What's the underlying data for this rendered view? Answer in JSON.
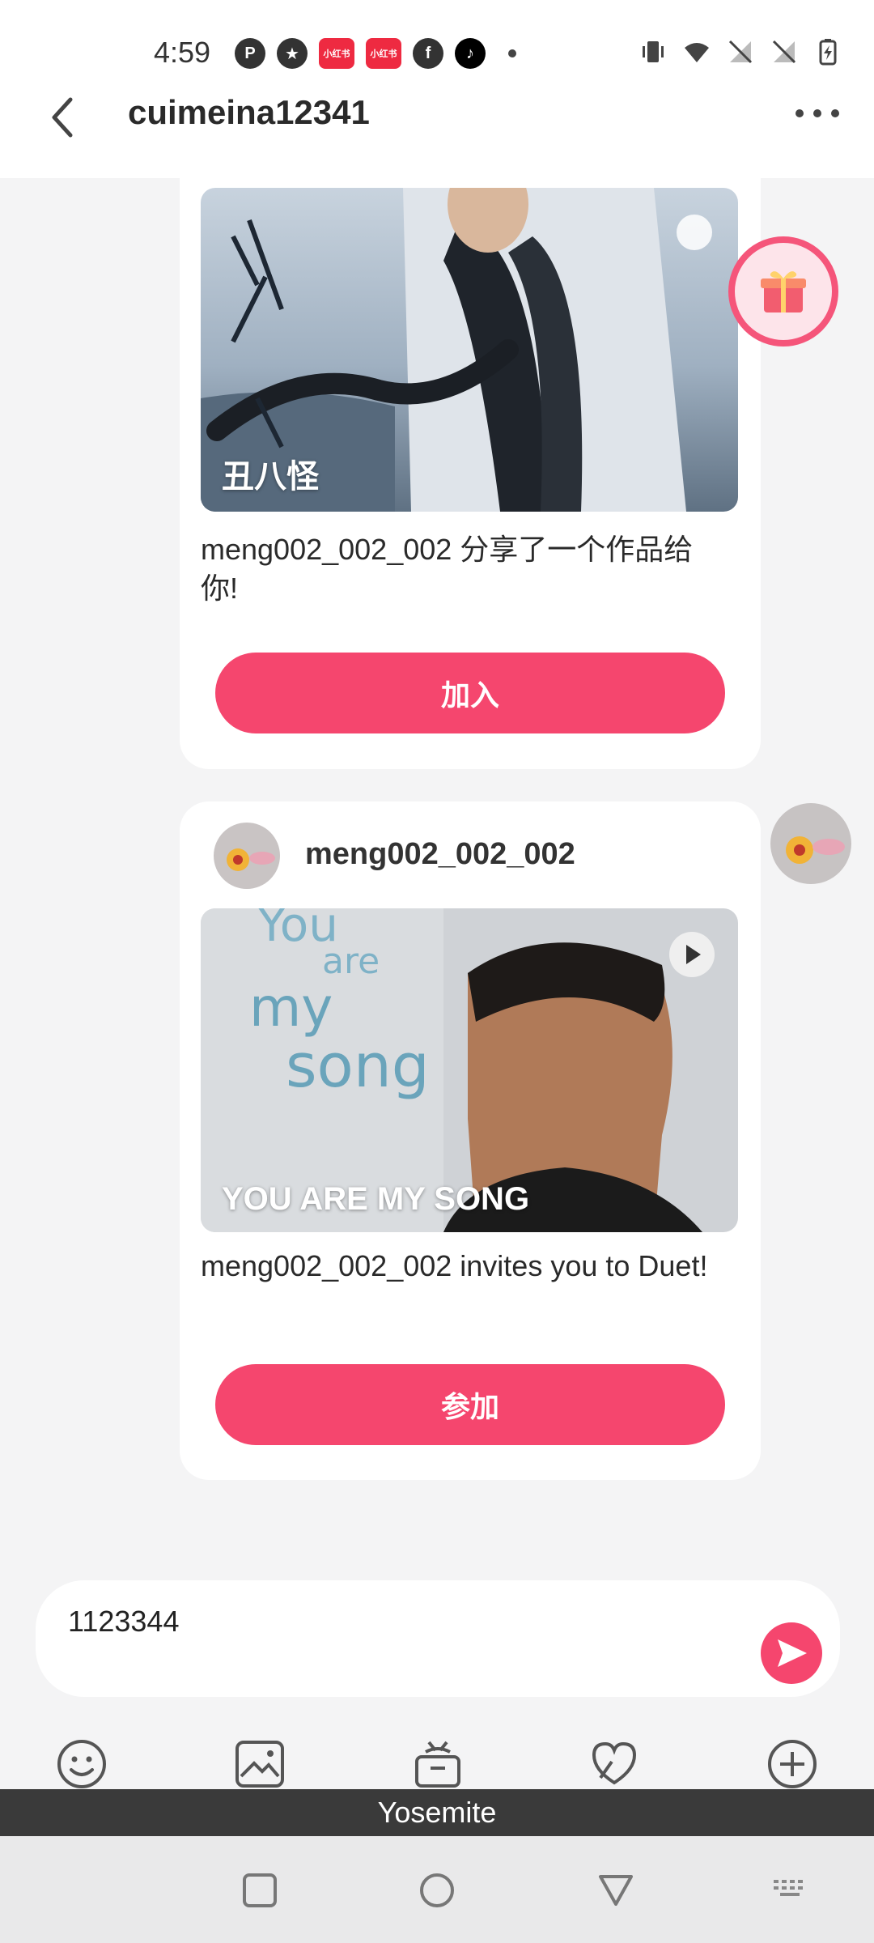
{
  "status_bar": {
    "time": "4:59",
    "left_icons": [
      "p-icon",
      "star-icon",
      "xiaohongshu-icon",
      "xiaohongshu-icon",
      "facebook-icon",
      "tiktok-icon"
    ],
    "app_badge_text": "小红书",
    "right_icons": [
      "vibrate-icon",
      "wifi-icon",
      "no-sim-icon",
      "no-sim-icon",
      "battery-charging-icon"
    ]
  },
  "header": {
    "title": "cuimeina12341"
  },
  "messages": [
    {
      "thumb_title": "丑八怪",
      "text": "meng002_002_002 分享了一个作品给你!",
      "button_label": "加入"
    },
    {
      "sender": "meng002_002_002",
      "thumb_title": "YOU ARE MY SONG",
      "text": "meng002_002_002 invites you to Duet!",
      "button_label": "参加"
    }
  ],
  "input": {
    "value": "1123344"
  },
  "toolbar": {
    "icons": [
      "emoji-icon",
      "image-icon",
      "gift-icon",
      "duet-icon",
      "plus-icon"
    ]
  },
  "keyboard_banner": {
    "label": "Yosemite"
  },
  "colors": {
    "accent": "#f5466e"
  }
}
